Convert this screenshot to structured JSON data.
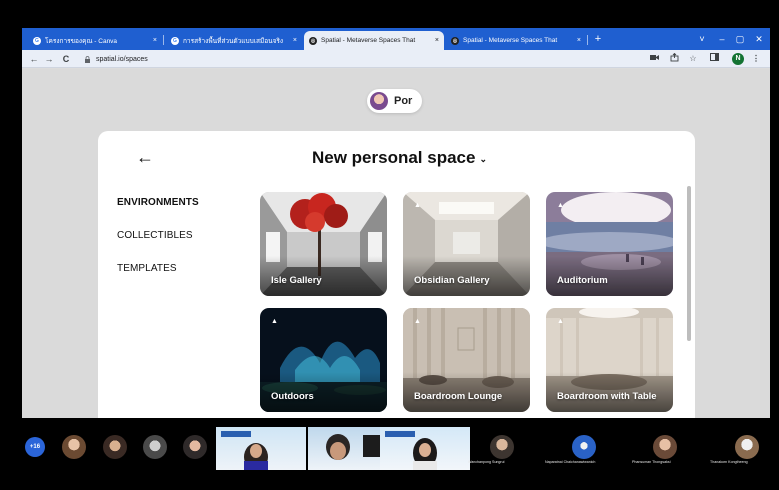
{
  "browser": {
    "tabs": [
      {
        "label": "โครงการของคุณ - Canva",
        "icon": "google-favicon",
        "active": false
      },
      {
        "label": "การสร้างพื้นที่ส่วนตัวแบบเสมือนจริง",
        "icon": "google-favicon",
        "active": false
      },
      {
        "label": "Spatial - Metaverse Spaces That",
        "icon": "spatial-favicon",
        "active": true
      },
      {
        "label": "Spatial - Metaverse Spaces That",
        "icon": "spatial-favicon",
        "active": false
      }
    ],
    "close_glyph": "×",
    "new_tab_glyph": "+",
    "window_controls": [
      "˅",
      "–",
      "▢",
      "✕"
    ],
    "nav": {
      "back": "←",
      "forward": "→",
      "reload": "C"
    },
    "url": "spatial.io/spaces",
    "profile_initial": "N",
    "toolbar_icons": [
      "camera-icon",
      "share-icon",
      "star-icon",
      "sidepanel-icon",
      "profile-icon",
      "menu-icon"
    ]
  },
  "page": {
    "user": {
      "name": "Por"
    },
    "modal": {
      "back_glyph": "←",
      "title": "New personal space",
      "title_chevron": "⌄",
      "categories": [
        {
          "label": "ENVIRONMENTS",
          "active": true
        },
        {
          "label": "COLLECTIBLES",
          "active": false
        },
        {
          "label": "TEMPLATES",
          "active": false
        }
      ],
      "environments": [
        {
          "label": "Isle Gallery",
          "icon": "mountain-icon"
        },
        {
          "label": "Obsidian Gallery",
          "icon": "mountain-icon"
        },
        {
          "label": "Auditorium",
          "icon": "mountain-icon"
        },
        {
          "label": "Outdoors",
          "icon": "mountain-icon"
        },
        {
          "label": "Boardroom Lounge",
          "icon": "mountain-icon"
        },
        {
          "label": "Boardroom with Table",
          "icon": "mountain-icon"
        }
      ]
    }
  },
  "meeting": {
    "more_participants": "+16",
    "participants": [
      {
        "name": "Wanchanpong Sungrui"
      },
      {
        "name": "Naparatnai Chaichanawiwanich"
      },
      {
        "name": "Phansuman Thongsaksi"
      },
      {
        "name": "Thanakorn Kongtheeng"
      }
    ]
  },
  "colors": {
    "tabbar": "#1f5fd0",
    "toolbar": "#e9eef7",
    "page_bg": "#dadada",
    "modal_bg": "#ffffff",
    "meeting_badge": "#2b65d9"
  }
}
